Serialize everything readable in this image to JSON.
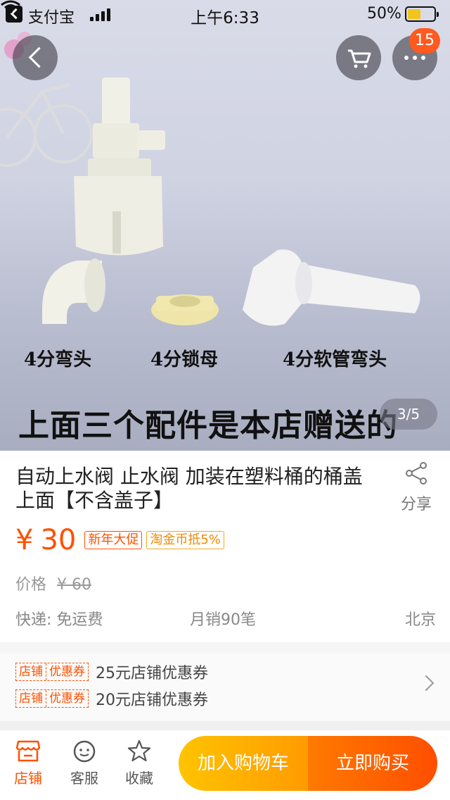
{
  "status_bar": {
    "back_app": "支付宝",
    "time": "上午6:33",
    "battery": "50%",
    "battery_level": 0.5
  },
  "gallery": {
    "captions": [
      "4分弯头",
      "4分锁母",
      "4分软管弯头"
    ],
    "main_caption": "上面三个配件是本店赠送的",
    "counter": "3/5",
    "more_badge": "15"
  },
  "product": {
    "title": "自动上水阀  止水阀 加装在塑料桶的桶盖上面【不含盖子】",
    "share_label": "分享",
    "currency": "¥",
    "price": "30",
    "tags": [
      "新年大促",
      "淘金币抵5%"
    ],
    "orig_label": "价格",
    "orig_price": "¥ 60",
    "shipping": "快递: 免运费",
    "monthly_sales": "月销90笔",
    "location": "北京"
  },
  "coupons": [
    {
      "tag1": "店铺",
      "tag2": "优惠券",
      "text": "25元店铺优惠券"
    },
    {
      "tag1": "店铺",
      "tag2": "优惠券",
      "text": "20元店铺优惠券"
    }
  ],
  "bottom_bar": {
    "store": "店铺",
    "service": "客服",
    "favorite": "收藏",
    "add_to_cart": "加入购物车",
    "buy_now": "立即购买"
  },
  "colors": {
    "accent": "#ff5000",
    "cart_button": "#ffb000",
    "buy_button": "#ff5a00"
  }
}
